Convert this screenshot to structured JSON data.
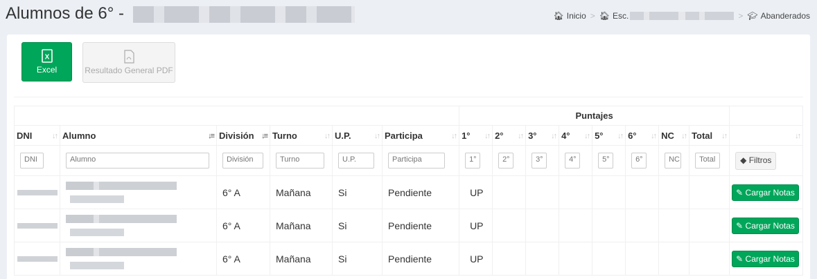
{
  "page": {
    "title": "Alumnos de 6° -"
  },
  "breadcrumb": {
    "items": [
      "Inicio",
      "Esc.",
      "Abanderados"
    ]
  },
  "toolbar": {
    "excel_label": "Excel",
    "pdf_label": "Resultado General PDF"
  },
  "table": {
    "group_header": "Puntajes",
    "columns": [
      "DNI",
      "Alumno",
      "División",
      "Turno",
      "U.P.",
      "Participa",
      "1°",
      "2°",
      "3°",
      "4°",
      "5°",
      "6°",
      "NC",
      "Total"
    ],
    "filter_placeholders": [
      "DNI",
      "Alumno",
      "División",
      "Turno",
      "U.P.",
      "Participa",
      "1°",
      "2°",
      "3°",
      "4°",
      "5°",
      "6°",
      "NC",
      "Total"
    ],
    "filter_button": "Filtros",
    "rows": [
      {
        "division": "6° A",
        "turno": "Mañana",
        "up": "Si",
        "participa": "Pendiente",
        "p1": "UP",
        "action": "Cargar Notas"
      },
      {
        "division": "6° A",
        "turno": "Mañana",
        "up": "Si",
        "participa": "Pendiente",
        "p1": "UP",
        "action": "Cargar Notas"
      },
      {
        "division": "6° A",
        "turno": "Mañana",
        "up": "Si",
        "participa": "Pendiente",
        "p1": "UP",
        "action": "Cargar Notas"
      }
    ]
  },
  "colors": {
    "success": "#00a65a",
    "background": "#ecf0f5"
  }
}
